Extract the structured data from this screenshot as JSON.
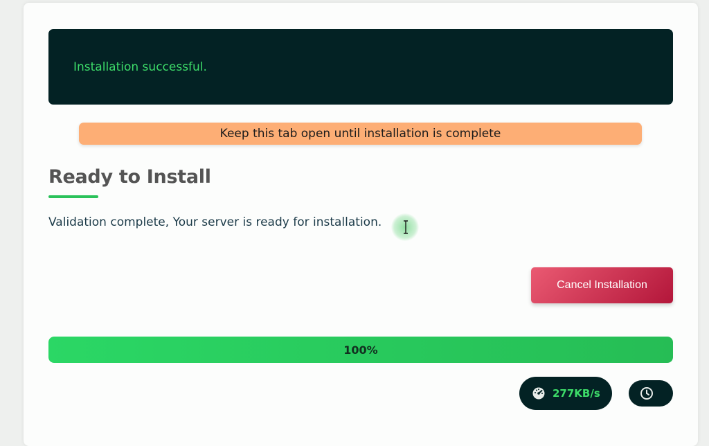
{
  "terminal": {
    "message": "Installation successful."
  },
  "warning": {
    "text": "Keep this tab open until installation is complete"
  },
  "section": {
    "title": "Ready to Install",
    "status_message": "Validation complete, Your server is ready for installation."
  },
  "actions": {
    "cancel_label": "Cancel Installation"
  },
  "progress": {
    "value": 1.0,
    "label": "100%"
  },
  "stats": {
    "speed": "277KB/s",
    "speed_icon": "speedometer-icon",
    "time_icon": "clock-icon"
  },
  "colors": {
    "terminal_bg": "#032224",
    "success_green": "#3ddc69",
    "warning_orange": "#fdae75",
    "cancel_red": "#c8274a",
    "progress_green": "#2bd765"
  }
}
